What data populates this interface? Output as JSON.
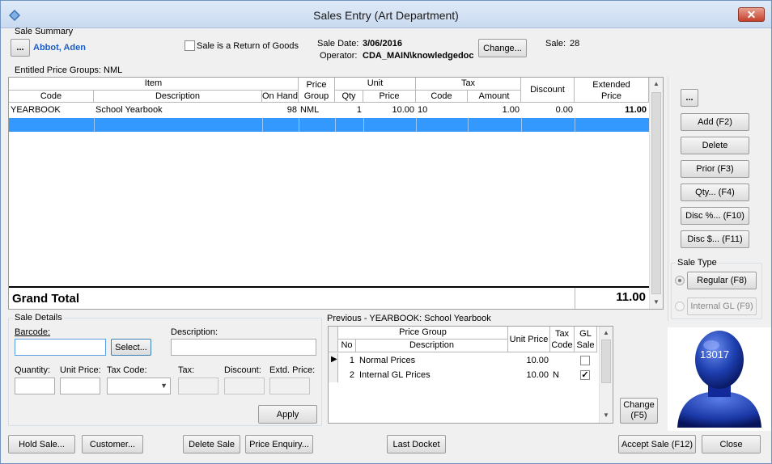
{
  "window": {
    "title": "Sales Entry (Art Department)",
    "close_label": "✕"
  },
  "summary": {
    "group_title": "Sale Summary",
    "customer_button": "...",
    "customer_name": "Abbot, Aden",
    "return_label": "Sale is a Return of Goods",
    "sale_date_label": "Sale Date:",
    "sale_date": "3/06/2016",
    "operator_label": "Operator:",
    "operator": "CDA_MAIN\\knowledgedoc",
    "change_label": "Change...",
    "sale_label": "Sale:",
    "sale_no": "28",
    "entitled_label": "Entitled Price Groups: NML"
  },
  "grid": {
    "headers": {
      "item": "Item",
      "code": "Code",
      "description": "Description",
      "on_hand": "On Hand",
      "price_group_1": "Price",
      "price_group_2": "Group",
      "unit": "Unit",
      "qty": "Qty",
      "price": "Price",
      "tax": "Tax",
      "tax_code": "Code",
      "amount": "Amount",
      "discount": "Discount",
      "extended_1": "Extended",
      "extended_2": "Price"
    },
    "rows": [
      {
        "code": "YEARBOOK",
        "description": "School Yearbook",
        "on_hand": "98",
        "price_group": "NML",
        "qty": "1",
        "price": "10.00",
        "tax_code": "10",
        "amount": "1.00",
        "discount": "0.00",
        "extended": "11.00"
      }
    ],
    "grand_total_label": "Grand Total",
    "grand_total": "11.00"
  },
  "side": {
    "more": "...",
    "add": "Add (F2)",
    "delete": "Delete",
    "prior": "Prior (F3)",
    "qty": "Qty... (F4)",
    "disc_pct": "Disc %... (F10)",
    "disc_amt": "Disc $... (F11)",
    "sale_type_title": "Sale Type",
    "regular": "Regular (F8)",
    "internal": "Internal GL (F9)",
    "avatar_number": "13017"
  },
  "details": {
    "group_title": "Sale Details",
    "barcode_label": "Barcode:",
    "select_label": "Select...",
    "description_label": "Description:",
    "quantity_label": "Quantity:",
    "unit_price_label": "Unit Price:",
    "tax_code_label": "Tax Code:",
    "tax_label": "Tax:",
    "discount_label": "Discount:",
    "extd_price_label": "Extd. Price:",
    "apply_label": "Apply"
  },
  "previous": {
    "title": "Previous - YEARBOOK: School Yearbook",
    "headers": {
      "price_group": "Price Group",
      "no": "No",
      "description": "Description",
      "unit_price": "Unit Price",
      "tax_code_1": "Tax",
      "tax_code_2": "Code",
      "gl_sale_1": "GL",
      "gl_sale_2": "Sale"
    },
    "rows": [
      {
        "no": "1",
        "description": "Normal Prices",
        "unit_price": "10.00",
        "tax_code": "",
        "gl_sale": false
      },
      {
        "no": "2",
        "description": "Internal GL Prices",
        "unit_price": "10.00",
        "tax_code": "N",
        "gl_sale": true
      }
    ],
    "change_label_1": "Change",
    "change_label_2": "(F5)"
  },
  "footer": {
    "hold": "Hold Sale...",
    "customer": "Customer...",
    "delete_sale": "Delete Sale",
    "price_enquiry": "Price Enquiry...",
    "last_docket": "Last Docket",
    "accept": "Accept Sale (F12)",
    "close": "Close"
  }
}
